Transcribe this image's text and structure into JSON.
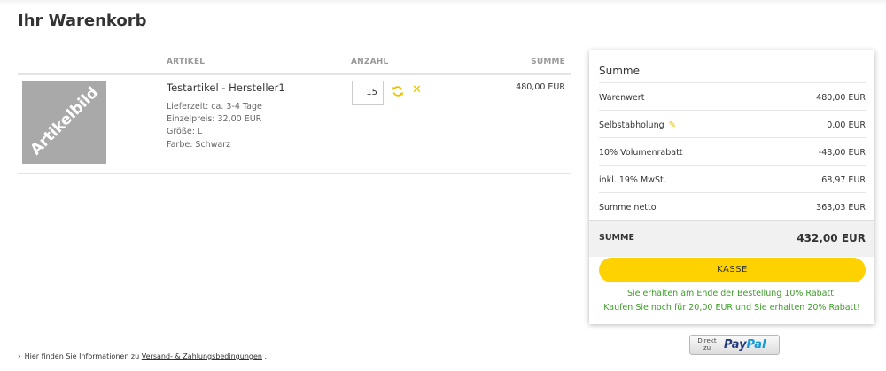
{
  "page": {
    "title": "Ihr Warenkorb"
  },
  "table": {
    "headers": {
      "artikel": "ARTIKEL",
      "anzahl": "ANZAHL",
      "summe": "SUMME"
    }
  },
  "item": {
    "image_label": "Artikelbild",
    "name": "Testartikel - Hersteller1",
    "attributes": [
      "Lieferzeit: ca. 3-4 Tage",
      "Einzelpreis: 32,00 EUR",
      "Größe: L",
      "Farbe: Schwarz"
    ],
    "quantity": "15",
    "total": "480,00 EUR",
    "icons": {
      "refresh": "refresh-icon",
      "remove": "close-icon"
    }
  },
  "summary": {
    "title": "Summe",
    "rows": [
      {
        "label": "Warenwert",
        "value": "480,00 EUR"
      },
      {
        "label": "Selbstabholung",
        "value": "0,00 EUR",
        "icon": "pencil-icon"
      },
      {
        "label": "10% Volumenrabatt",
        "value": "-48,00 EUR"
      },
      {
        "label": "inkl. 19% MwSt.",
        "value": "68,97 EUR"
      },
      {
        "label": "Summe netto",
        "value": "363,03 EUR"
      }
    ],
    "total_label": "SUMME",
    "total_value": "432,00 EUR",
    "checkout_label": "KASSE",
    "promo_lines": [
      "Sie erhalten am Ende der Bestellung 10% Rabatt.",
      "Kaufen Sie noch für 20,00 EUR und Sie erhalten 20% Rabatt!"
    ],
    "accent_color": "#fdd200",
    "promo_color": "#3f9c2a"
  },
  "paypal": {
    "prefix_line1": "Direkt",
    "prefix_line2": "zu",
    "logo_part1": "Pay",
    "logo_part2": "Pal"
  },
  "footer": {
    "text": "Hier finden Sie Informationen zu",
    "link": "Versand- & Zahlungsbedingungen",
    "suffix": "."
  }
}
